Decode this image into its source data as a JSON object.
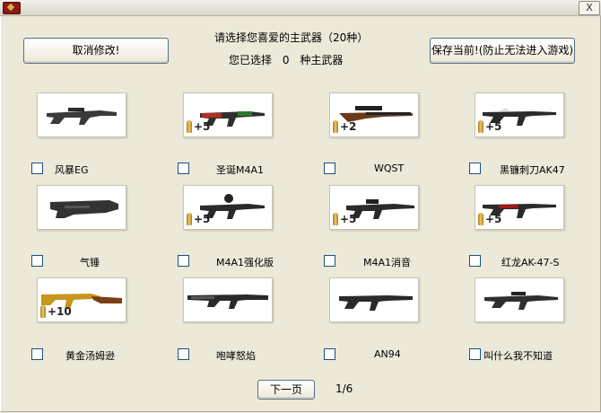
{
  "window": {
    "close_symbol": "X"
  },
  "header": {
    "title": "请选择您喜爱的主武器（20种）",
    "selected_prefix": "您已选择",
    "selected_count": "0",
    "selected_suffix": "种主武器"
  },
  "buttons": {
    "cancel": "取消修改!",
    "save": "保存当前!(防止无法进入游戏)",
    "next": "下一页"
  },
  "pagination": {
    "page": "1/6"
  },
  "weapons": [
    {
      "name": "风暴EG",
      "badge": "",
      "checked": false
    },
    {
      "name": "圣诞M4A1",
      "badge": "+5",
      "checked": false
    },
    {
      "name": "WQST",
      "badge": "+2",
      "checked": false
    },
    {
      "name": "黑镰刺刀AK47",
      "badge": "+5",
      "checked": false
    },
    {
      "name": "气锤",
      "badge": "",
      "checked": false
    },
    {
      "name": "M4A1强化版",
      "badge": "+5",
      "checked": false
    },
    {
      "name": "M4A1消音",
      "badge": "+5",
      "checked": false
    },
    {
      "name": "红龙AK-47-S",
      "badge": "+5",
      "checked": false
    },
    {
      "name": "黄金汤姆逊",
      "badge": "+10",
      "checked": false
    },
    {
      "name": "咆哮怒焰",
      "badge": "",
      "checked": false
    },
    {
      "name": "AN94",
      "badge": "",
      "checked": false
    },
    {
      "name": "叫什么我不知道",
      "badge": "",
      "checked": false
    }
  ]
}
